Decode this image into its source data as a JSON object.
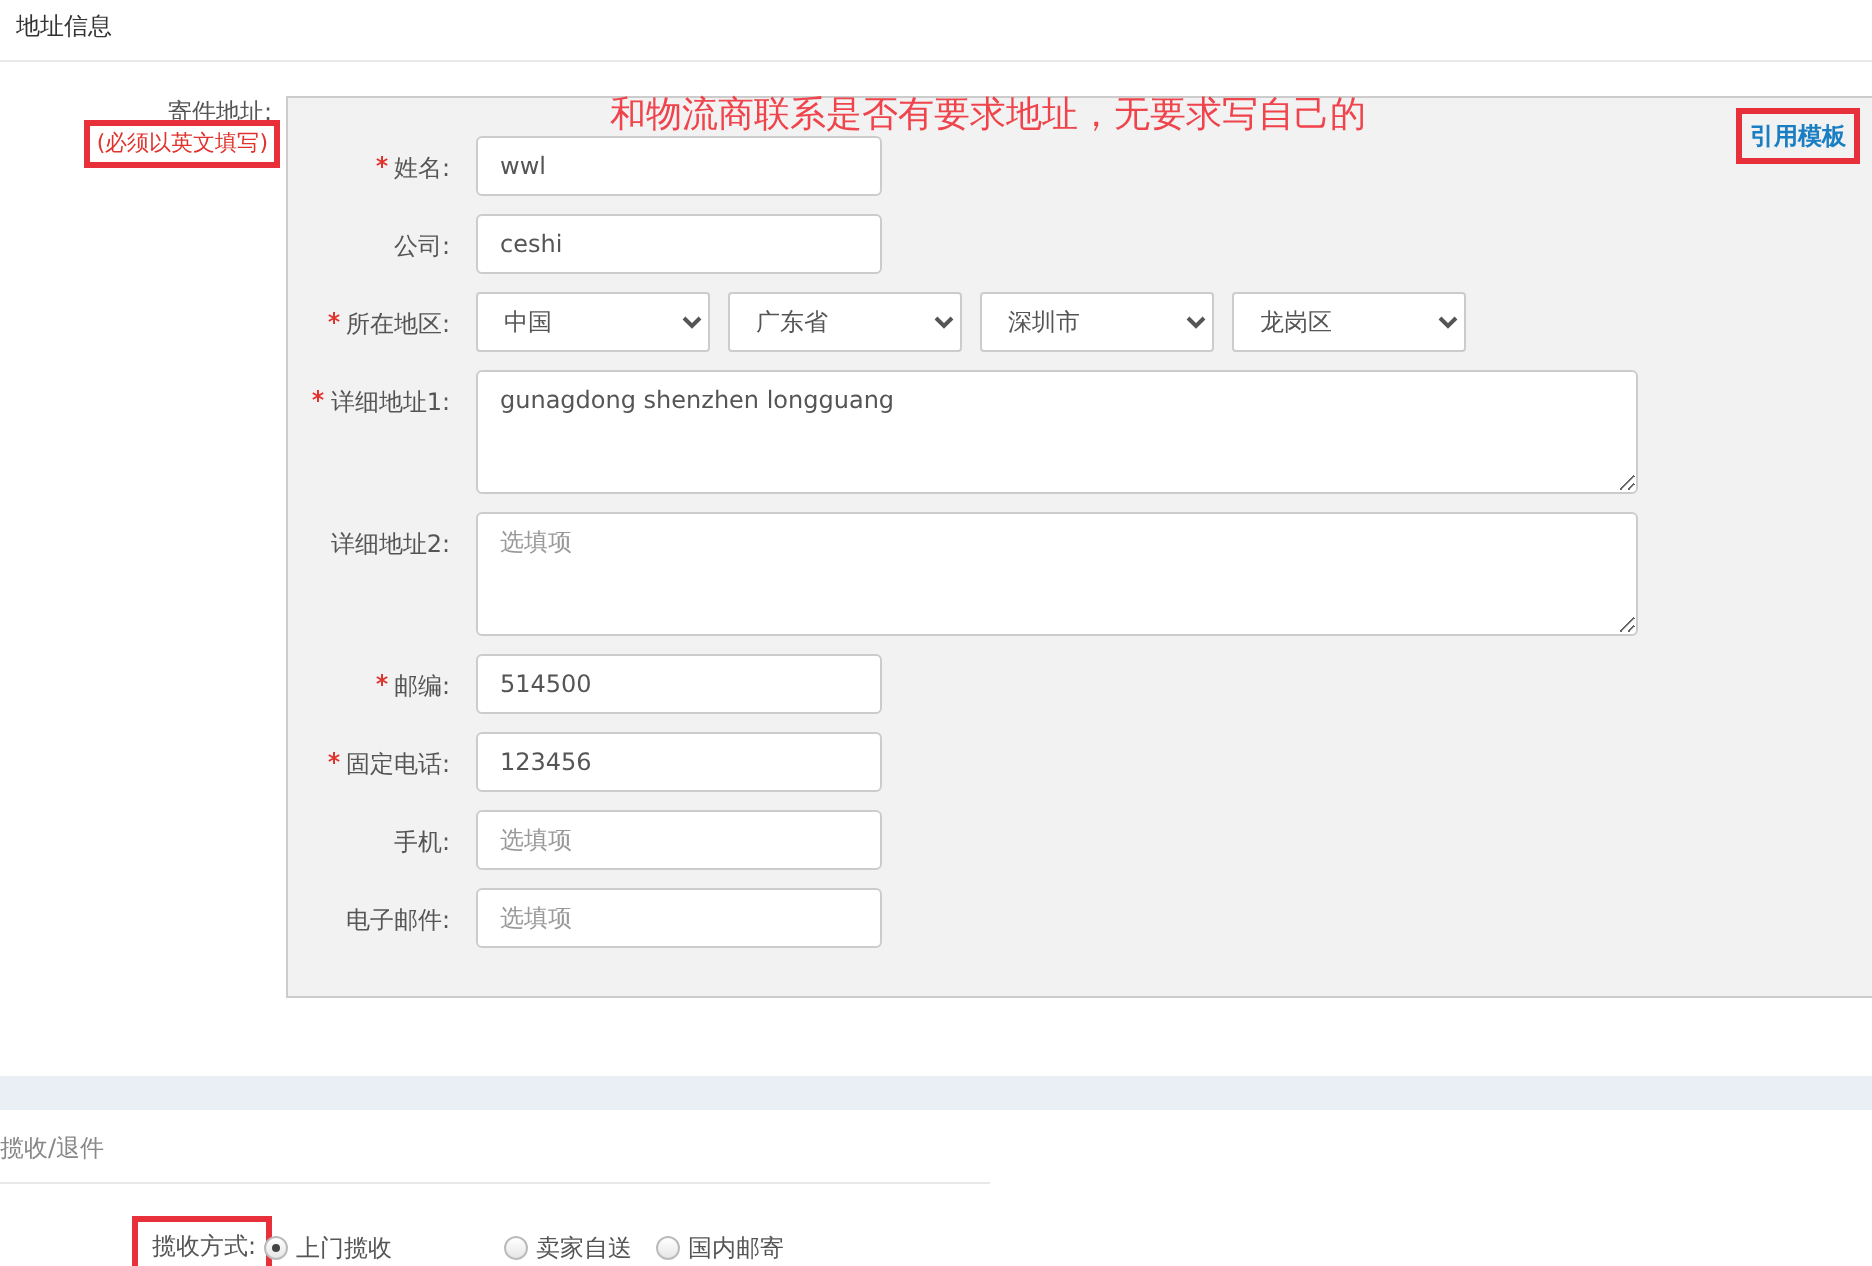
{
  "section_title": "地址信息",
  "sender": {
    "label": "寄件地址:",
    "note": "(必须以英文填写)",
    "note_highlighted": true
  },
  "annotation": "和物流商联系是否有要求地址，无要求写自己的",
  "template_link": {
    "label": "引用模板",
    "highlighted": true
  },
  "fields": [
    {
      "kind": "text",
      "label": "姓名:",
      "required": true,
      "value": "wwl"
    },
    {
      "kind": "text",
      "label": "公司:",
      "required": false,
      "value": "ceshi"
    },
    {
      "kind": "select",
      "label": "所在地区:",
      "required": true,
      "options": [
        "中国",
        "广东省",
        "深圳市",
        "龙岗区"
      ]
    },
    {
      "kind": "textarea",
      "label": "详细地址1:",
      "required": true,
      "value": "gunagdong shenzhen longguang"
    },
    {
      "kind": "textarea",
      "label": "详细地址2:",
      "required": false,
      "placeholder": "选填项"
    },
    {
      "kind": "text",
      "label": "邮编:",
      "required": true,
      "value": "514500"
    },
    {
      "kind": "text",
      "label": "固定电话:",
      "required": true,
      "value": "123456"
    },
    {
      "kind": "text",
      "label": "手机:",
      "required": false,
      "placeholder": "选填项"
    },
    {
      "kind": "text",
      "label": "电子邮件:",
      "required": false,
      "placeholder": "选填项"
    }
  ],
  "pickup_section_title": "揽收/退件",
  "pickup": {
    "label": "揽收方式:",
    "highlighted": true,
    "options": [
      {
        "label": "上门揽收",
        "selected": true
      },
      {
        "label": "卖家自送",
        "selected": false
      },
      {
        "label": "国内邮寄",
        "selected": false
      }
    ]
  }
}
